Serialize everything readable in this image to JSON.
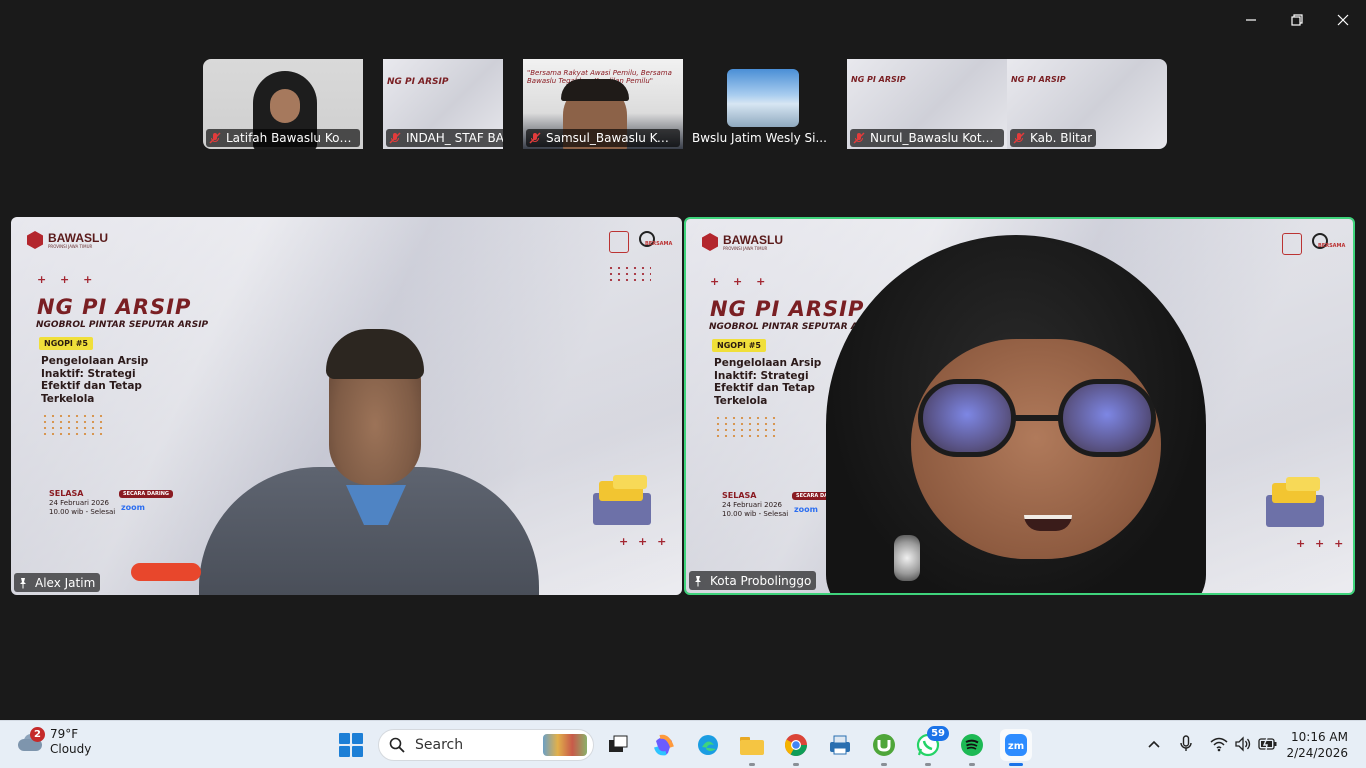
{
  "window": {
    "minimize_icon": "minimize-icon",
    "restore_icon": "restore-icon",
    "close_icon": "close-icon"
  },
  "thumbnails": [
    {
      "name": "Latifah Bawaslu Kota ...",
      "muted": true
    },
    {
      "name": "INDAH_ STAF BAWASL...",
      "muted": true
    },
    {
      "name": "Samsul_Bawaslu Kota...",
      "muted": true
    },
    {
      "name": "Bwslu Jatim Wesly Si...",
      "muted": false
    },
    {
      "name": "Nurul_Bawaslu Kota P...",
      "muted": true
    },
    {
      "name": "Kab. Blitar",
      "muted": true
    }
  ],
  "slide": {
    "brand": "BAWASLU",
    "brand_sub": "PROVINSI JAWA TIMUR",
    "plus": "+ + +",
    "title": "NG   PI ARSIP",
    "subtitle": "NGOBROL PINTAR SEPUTAR ARSIP",
    "badge": "NGOPI #5",
    "topic": "Pengelolaan Arsip\nInaktif: Strategi\nEfektif dan Tetap\nTerkelola",
    "day": "SELASA",
    "date": "24 Februari 2026",
    "time": "10.00 wib - Selesai",
    "online": "SECARA DARING",
    "zoom": "zoom"
  },
  "tiles": {
    "left_name": "Alex Jatim",
    "right_name": "Kota Probolinggo"
  },
  "taskbar": {
    "weather_badge": "2",
    "temperature": "79°F",
    "condition": "Cloudy",
    "search_placeholder": "Search",
    "whatsapp_badge": "59",
    "time": "10:16 AM",
    "date": "2/24/2026",
    "colors": {
      "accent": "#1a73e8",
      "active_border": "#3fd47c"
    }
  }
}
